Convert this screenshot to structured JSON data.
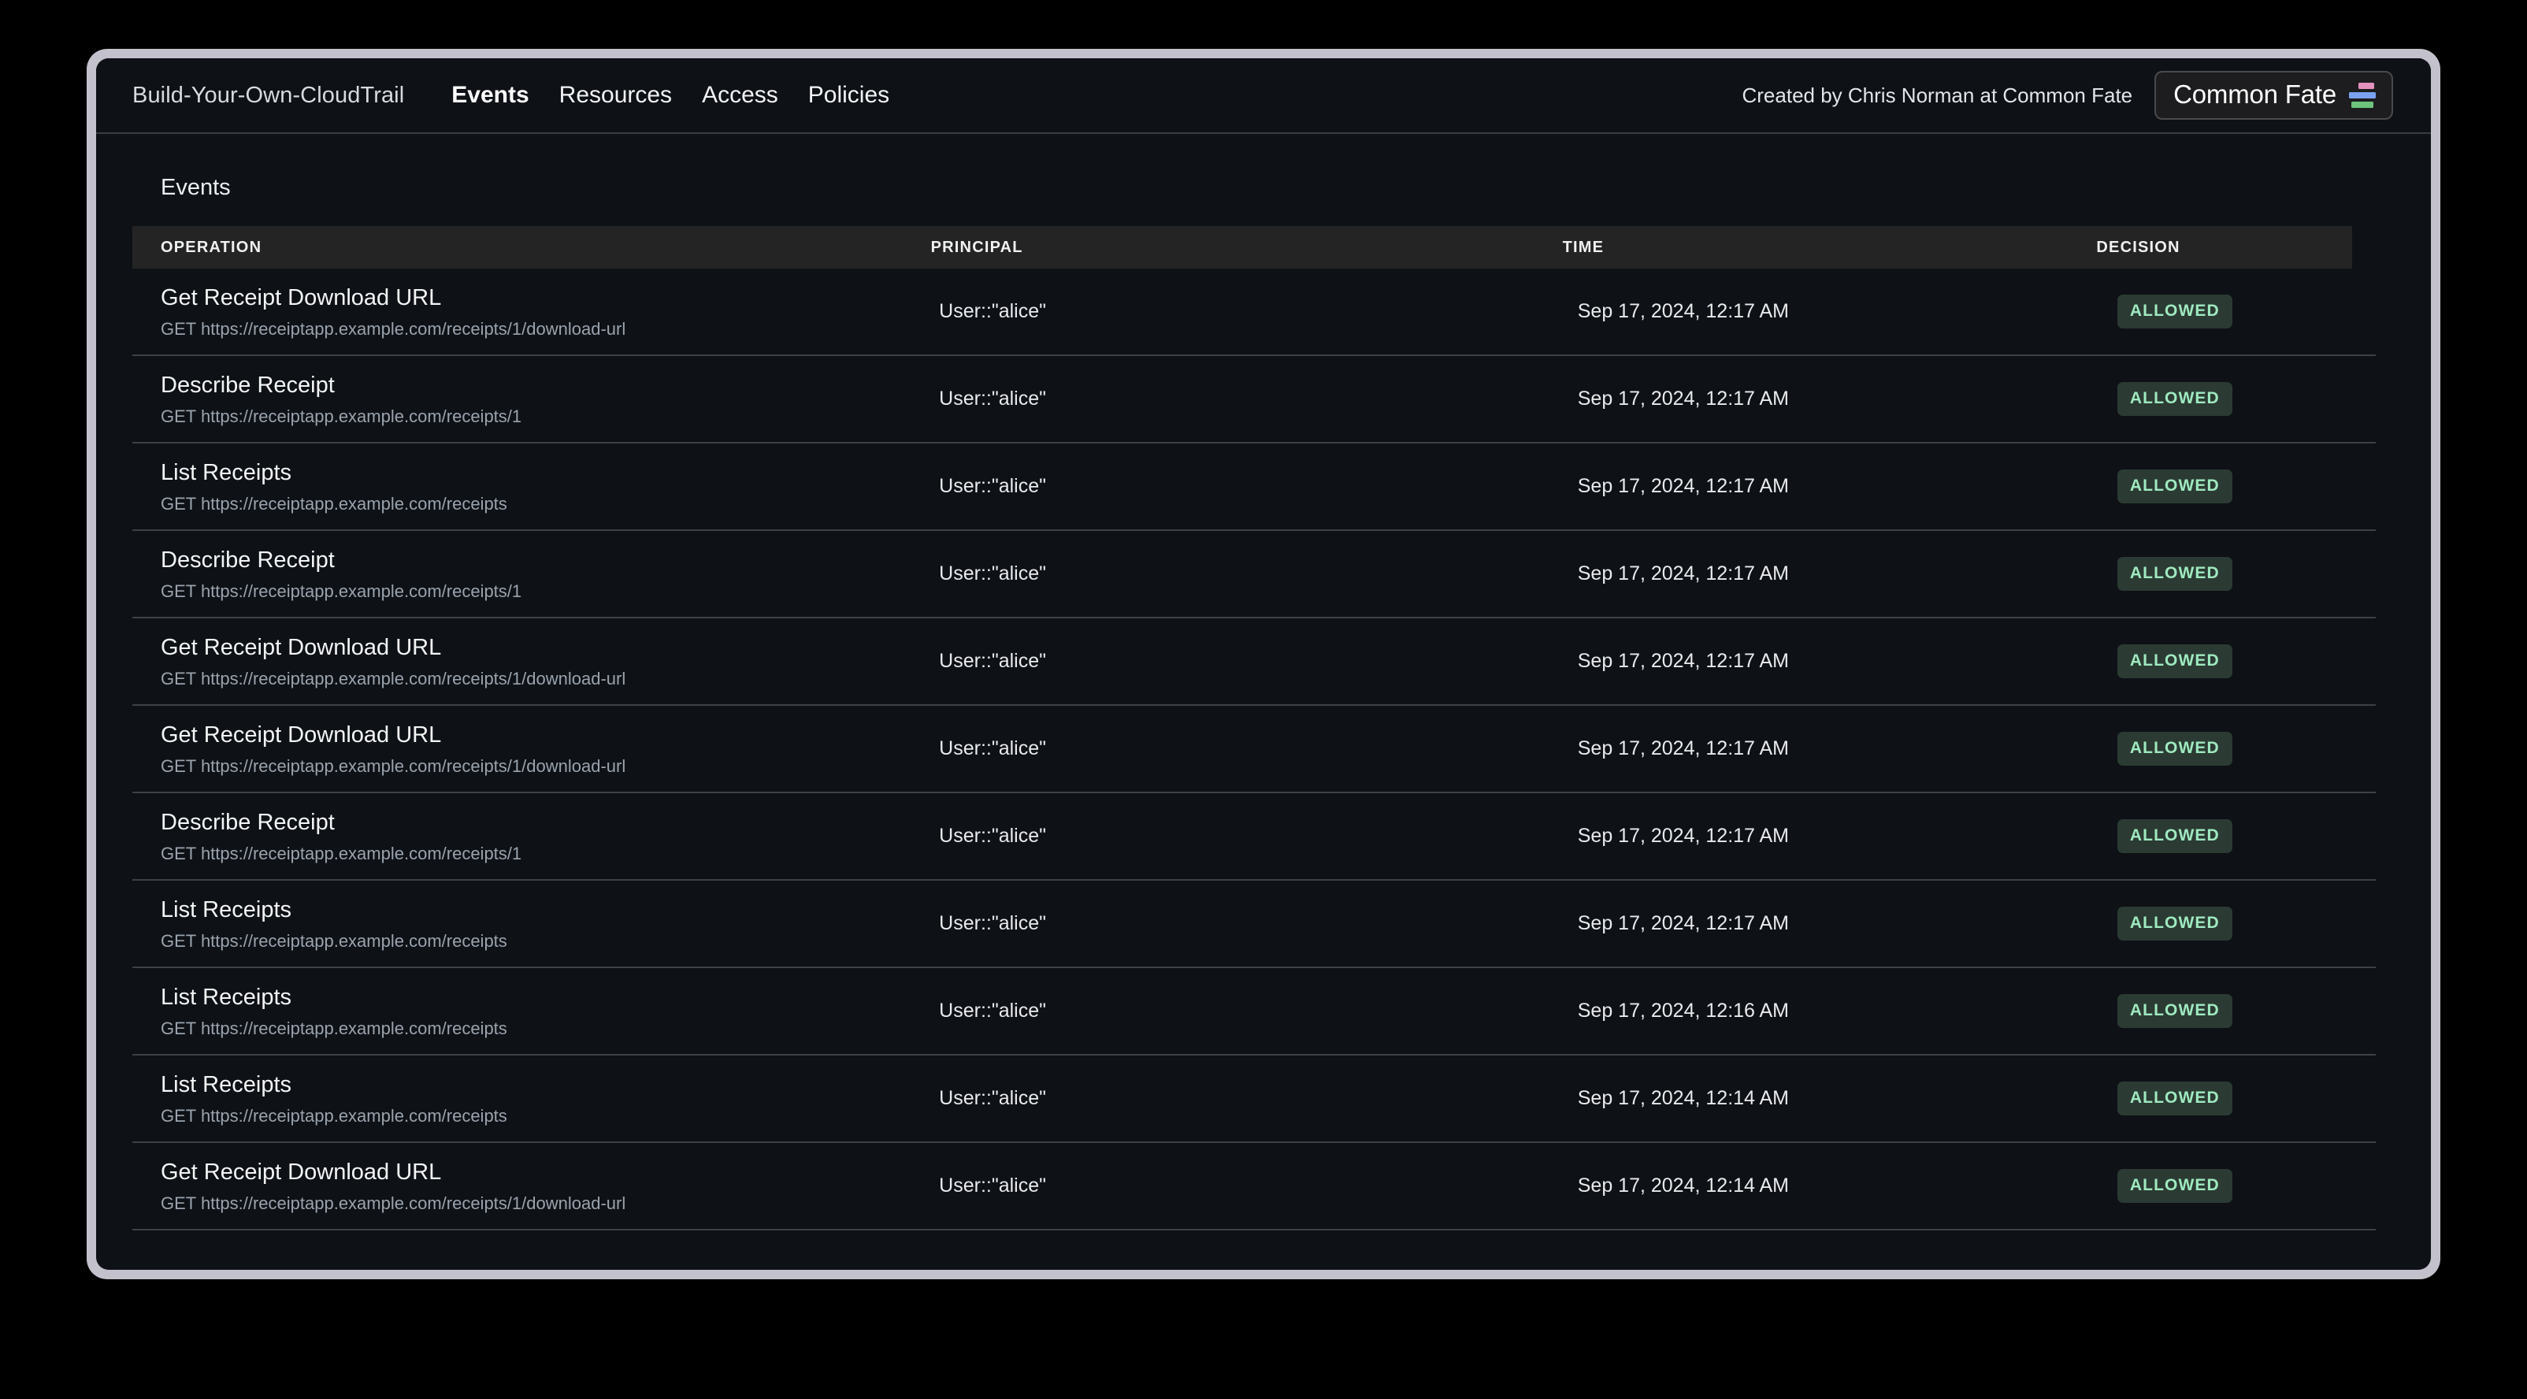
{
  "window": {
    "frame_color": "#c3c2cc",
    "app_background": "#0e1116"
  },
  "topnav": {
    "brand": "Build-Your-Own-CloudTrail",
    "links": [
      {
        "label": "Events",
        "active": true
      },
      {
        "label": "Resources",
        "active": false
      },
      {
        "label": "Access",
        "active": false
      },
      {
        "label": "Policies",
        "active": false
      }
    ],
    "credit": "Created by Chris Norman at Common Fate",
    "badge": {
      "label": "Common Fate",
      "logo_colors": {
        "pink": "#e391bd",
        "blue": "#7aa2f0",
        "green": "#6cc47d"
      }
    }
  },
  "page": {
    "title": "Events"
  },
  "table": {
    "columns": [
      "OPERATION",
      "PRINCIPAL",
      "TIME",
      "DECISION"
    ],
    "decision_colors": {
      "allowed_bg": "#2b3b33",
      "allowed_text": "#9fe9c0"
    },
    "rows": [
      {
        "operation": "Get Receipt Download URL",
        "url": "GET https://receiptapp.example.com/receipts/1/download-url",
        "principal": "User::\"alice\"",
        "time": "Sep 17, 2024, 12:17 AM",
        "decision": "ALLOWED"
      },
      {
        "operation": "Describe Receipt",
        "url": "GET https://receiptapp.example.com/receipts/1",
        "principal": "User::\"alice\"",
        "time": "Sep 17, 2024, 12:17 AM",
        "decision": "ALLOWED"
      },
      {
        "operation": "List Receipts",
        "url": "GET https://receiptapp.example.com/receipts",
        "principal": "User::\"alice\"",
        "time": "Sep 17, 2024, 12:17 AM",
        "decision": "ALLOWED"
      },
      {
        "operation": "Describe Receipt",
        "url": "GET https://receiptapp.example.com/receipts/1",
        "principal": "User::\"alice\"",
        "time": "Sep 17, 2024, 12:17 AM",
        "decision": "ALLOWED"
      },
      {
        "operation": "Get Receipt Download URL",
        "url": "GET https://receiptapp.example.com/receipts/1/download-url",
        "principal": "User::\"alice\"",
        "time": "Sep 17, 2024, 12:17 AM",
        "decision": "ALLOWED"
      },
      {
        "operation": "Get Receipt Download URL",
        "url": "GET https://receiptapp.example.com/receipts/1/download-url",
        "principal": "User::\"alice\"",
        "time": "Sep 17, 2024, 12:17 AM",
        "decision": "ALLOWED"
      },
      {
        "operation": "Describe Receipt",
        "url": "GET https://receiptapp.example.com/receipts/1",
        "principal": "User::\"alice\"",
        "time": "Sep 17, 2024, 12:17 AM",
        "decision": "ALLOWED"
      },
      {
        "operation": "List Receipts",
        "url": "GET https://receiptapp.example.com/receipts",
        "principal": "User::\"alice\"",
        "time": "Sep 17, 2024, 12:17 AM",
        "decision": "ALLOWED"
      },
      {
        "operation": "List Receipts",
        "url": "GET https://receiptapp.example.com/receipts",
        "principal": "User::\"alice\"",
        "time": "Sep 17, 2024, 12:16 AM",
        "decision": "ALLOWED"
      },
      {
        "operation": "List Receipts",
        "url": "GET https://receiptapp.example.com/receipts",
        "principal": "User::\"alice\"",
        "time": "Sep 17, 2024, 12:14 AM",
        "decision": "ALLOWED"
      },
      {
        "operation": "Get Receipt Download URL",
        "url": "GET https://receiptapp.example.com/receipts/1/download-url",
        "principal": "User::\"alice\"",
        "time": "Sep 17, 2024, 12:14 AM",
        "decision": "ALLOWED"
      }
    ]
  }
}
